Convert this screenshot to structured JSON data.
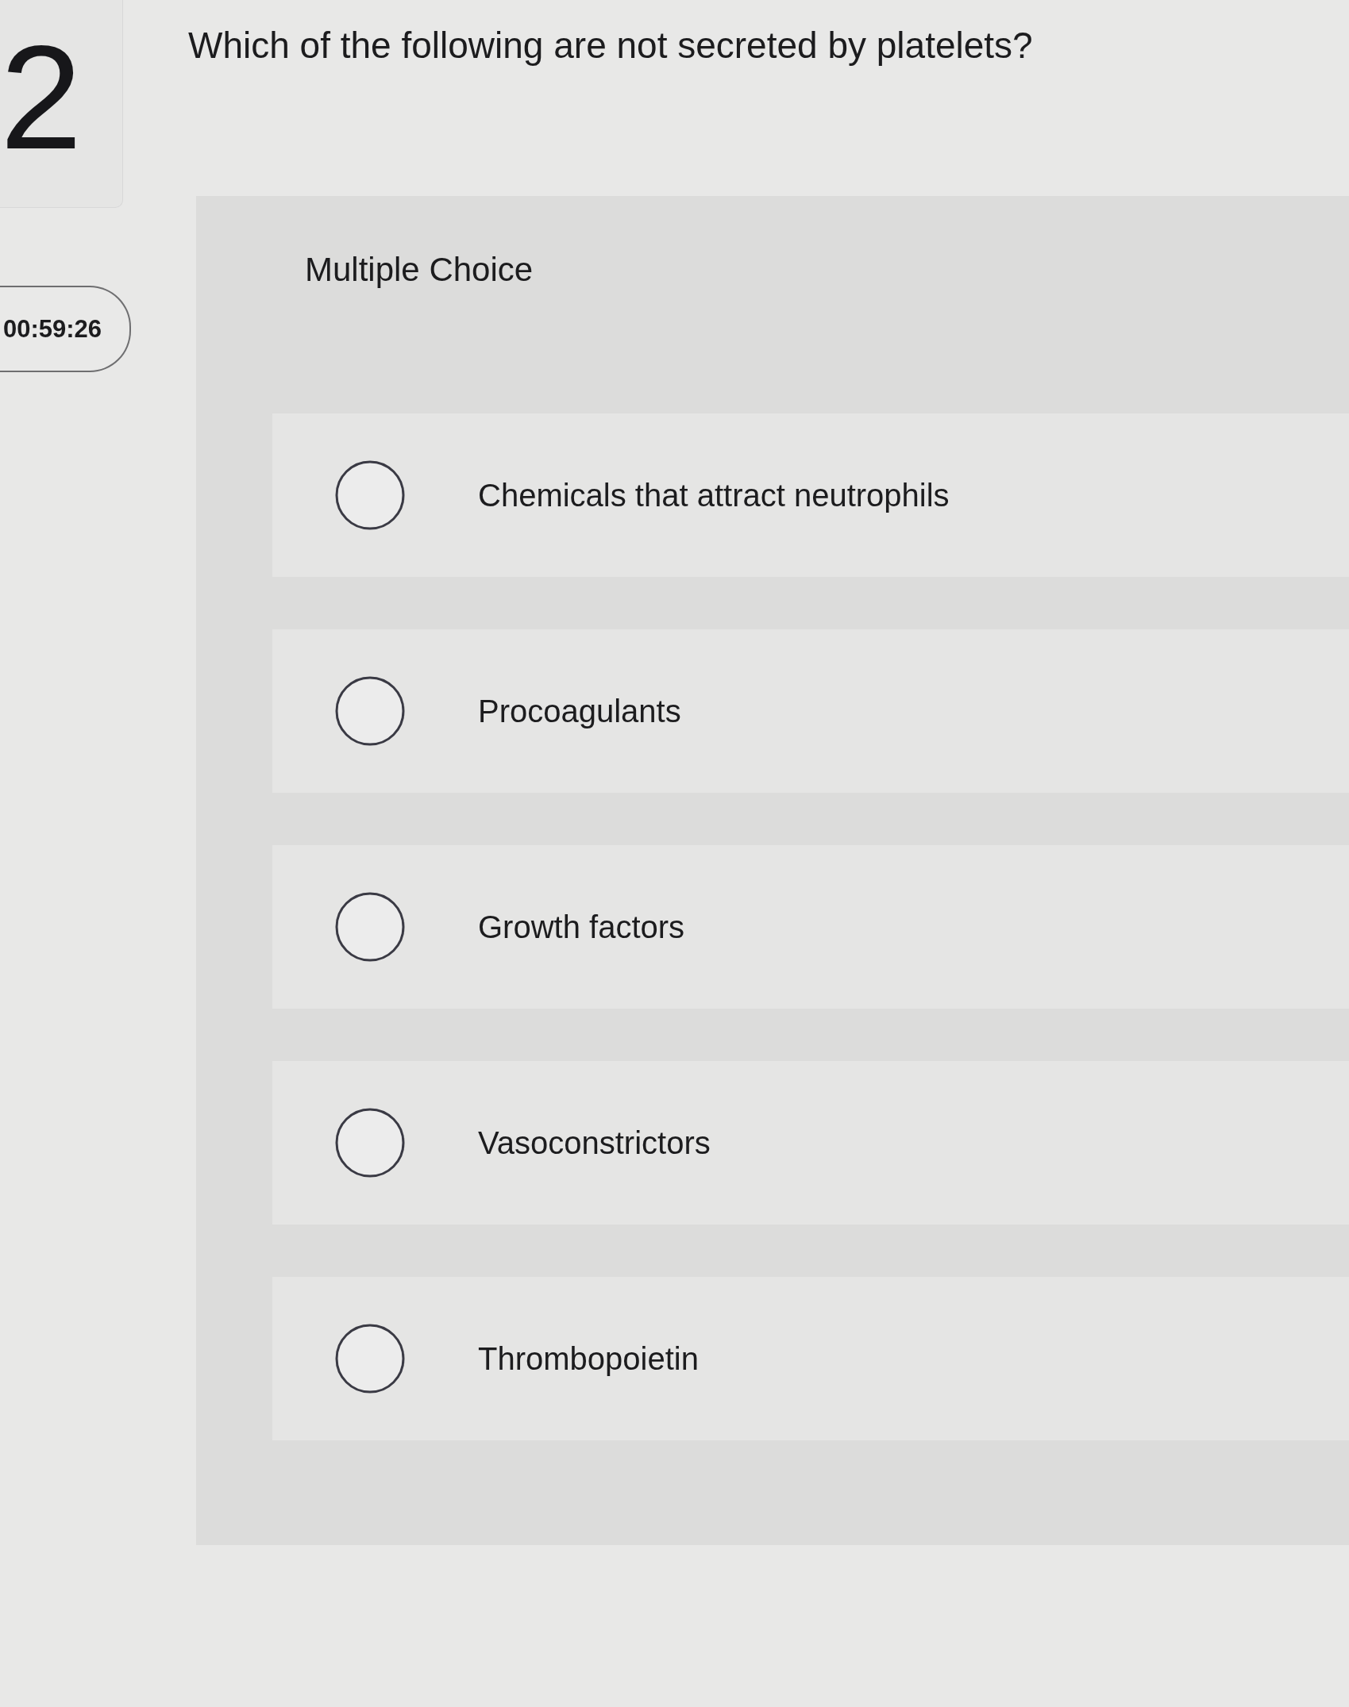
{
  "question_number": "2",
  "question": "Which of the following are not secreted by platelets?",
  "timer": "00:59:26",
  "answer_panel": {
    "type_label": "Multiple Choice",
    "options": [
      {
        "label": "Chemicals that attract neutrophils",
        "selected": false
      },
      {
        "label": "Procoagulants",
        "selected": false
      },
      {
        "label": "Growth factors",
        "selected": false
      },
      {
        "label": "Vasoconstrictors",
        "selected": false
      },
      {
        "label": "Thrombopoietin",
        "selected": false
      }
    ]
  }
}
